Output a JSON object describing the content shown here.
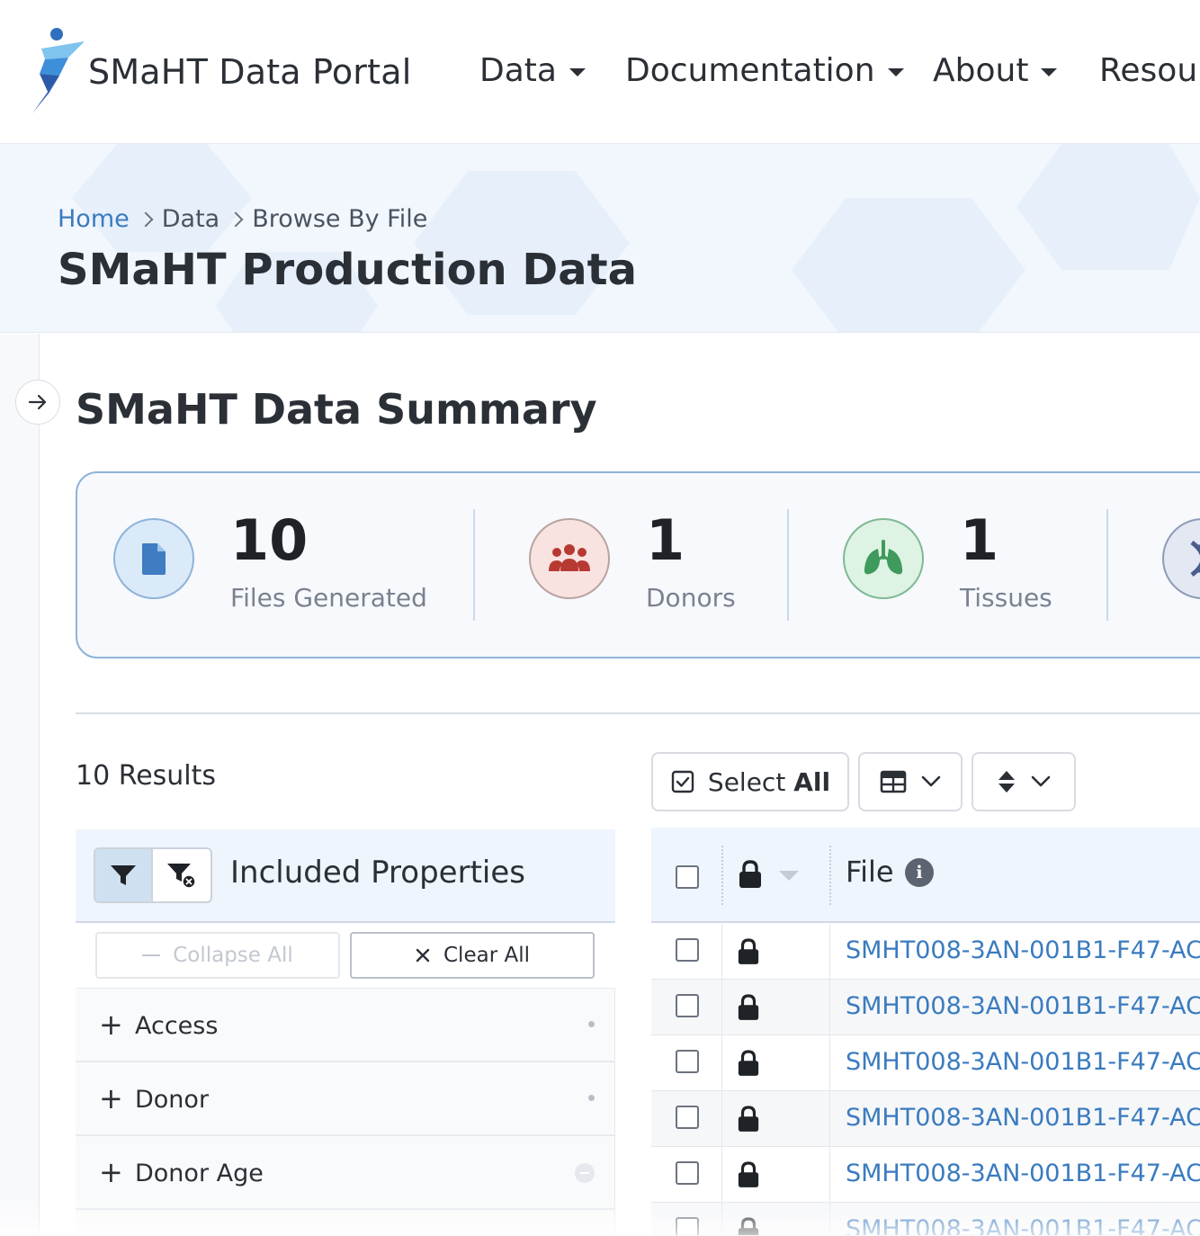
{
  "nav": {
    "brand": "SMaHT Data Portal",
    "items": [
      {
        "label": "Data"
      },
      {
        "label": "Documentation"
      },
      {
        "label": "About"
      },
      {
        "label": "Resour"
      }
    ]
  },
  "breadcrumb": [
    "Home",
    "Data",
    "Browse By File"
  ],
  "page_title": "SMaHT Production Data",
  "summary": {
    "title": "SMaHT Data Summary",
    "stats": [
      {
        "value": "10",
        "label": "Files Generated",
        "icon": "file-icon",
        "color": "#3f7cc2"
      },
      {
        "value": "1",
        "label": "Donors",
        "icon": "users-icon",
        "color": "#b73a32"
      },
      {
        "value": "1",
        "label": "Tissues",
        "icon": "lungs-icon",
        "color": "#3f9a5d"
      },
      {
        "value": "",
        "label": "",
        "icon": "dna-icon",
        "color": "#4a5d8c"
      }
    ]
  },
  "results": {
    "count_label": "10 Results",
    "select_all_prefix": "Select ",
    "select_all_bold": "All"
  },
  "facets": {
    "title": "Included Properties",
    "collapse_label": "Collapse All",
    "clear_label": "Clear All",
    "items": [
      {
        "label": "Access"
      },
      {
        "label": "Donor"
      },
      {
        "label": "Donor Age"
      }
    ]
  },
  "table": {
    "file_header": "File",
    "info_glyph": "i",
    "rows": [
      {
        "file": "SMHT008-3AN-001B1-F47-AC"
      },
      {
        "file": "SMHT008-3AN-001B1-F47-AC"
      },
      {
        "file": "SMHT008-3AN-001B1-F47-AC"
      },
      {
        "file": "SMHT008-3AN-001B1-F47-AC"
      },
      {
        "file": "SMHT008-3AN-001B1-F47-AC"
      },
      {
        "file": "SMHT008-3AN-001B1-F47-AC"
      }
    ]
  },
  "colors": {
    "accent": "#3a7bbf",
    "card_border": "#8fb3da",
    "header_bg": "#f2f7fd"
  }
}
